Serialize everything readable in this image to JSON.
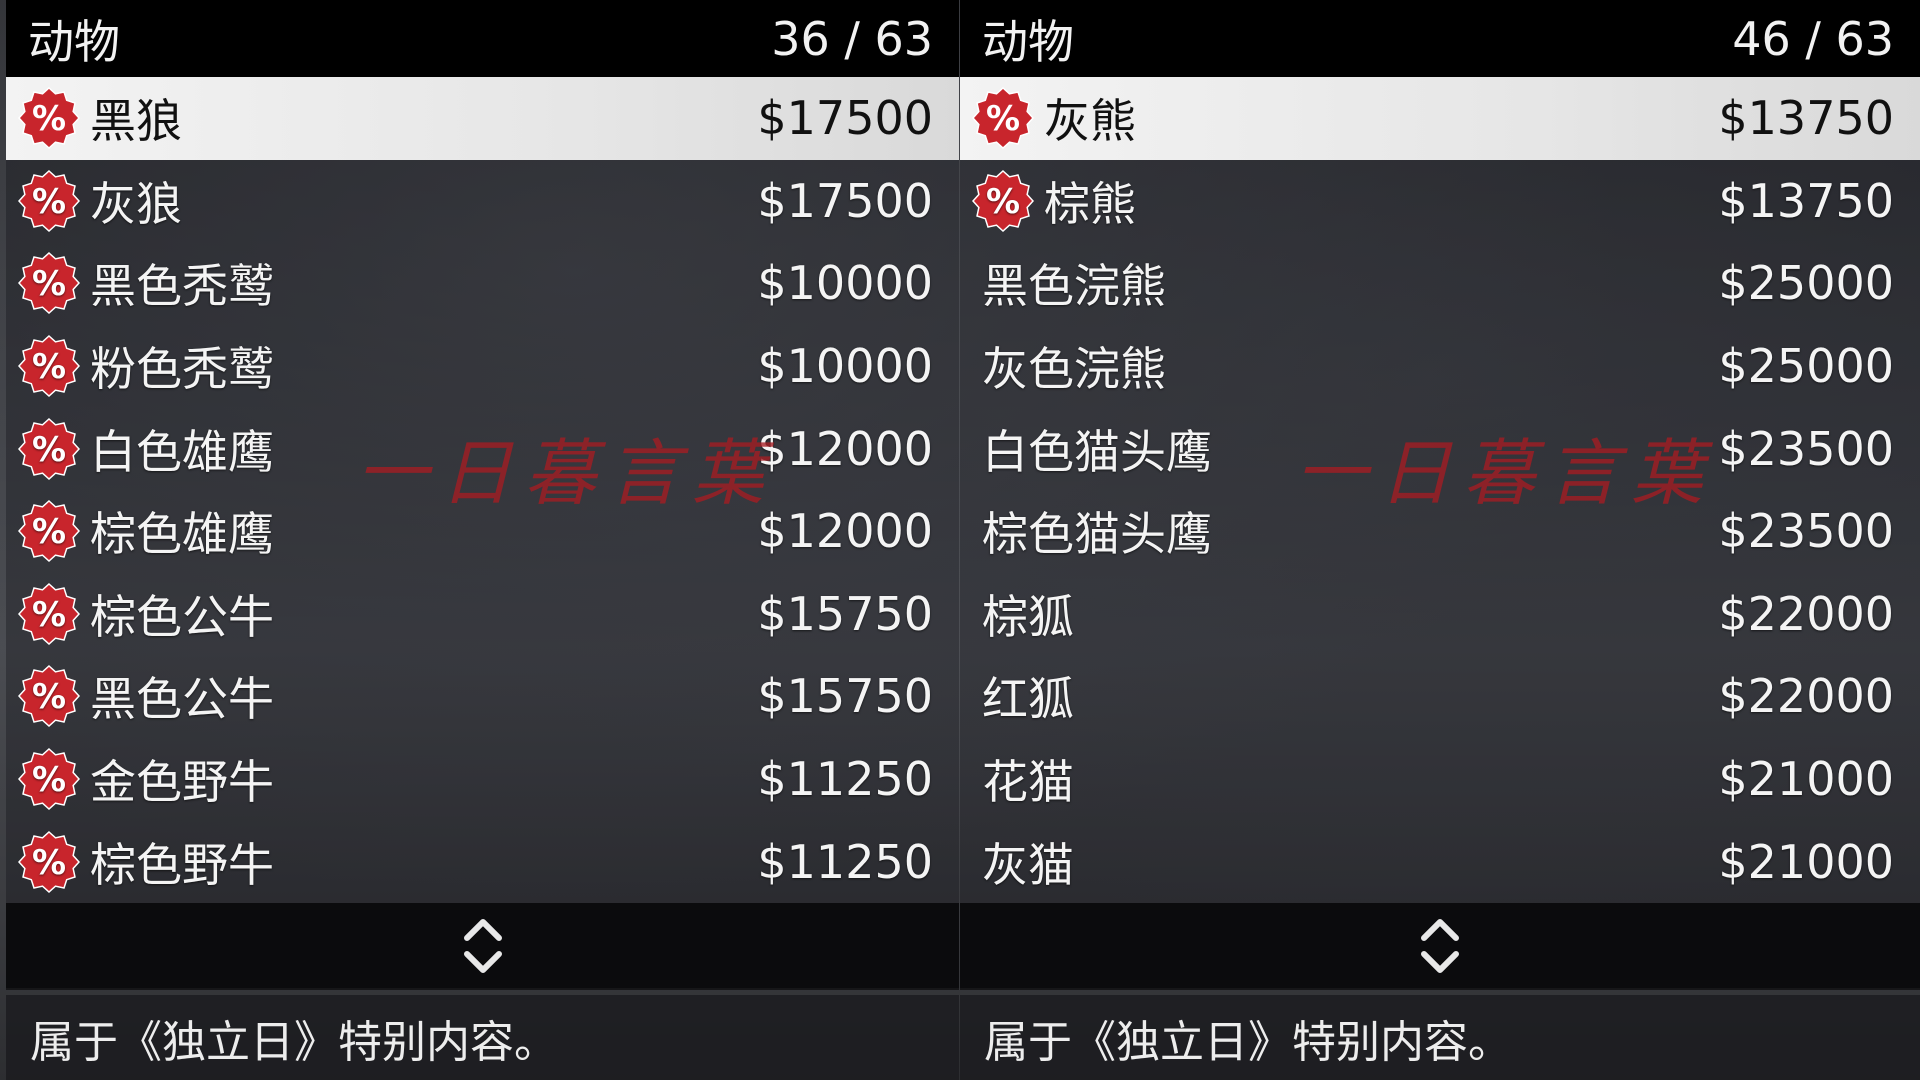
{
  "colors": {
    "accent_red": "#c8252c",
    "header_bg": "#000000",
    "selected_bg": "#e6e6e6"
  },
  "watermark": "一日暮言葉",
  "panels": [
    {
      "title": "动物",
      "counter": "36 / 63",
      "items": [
        {
          "label": "黑狼",
          "price": "$17500",
          "discount": true,
          "selected": true
        },
        {
          "label": "灰狼",
          "price": "$17500",
          "discount": true
        },
        {
          "label": "黑色秃鹫",
          "price": "$10000",
          "discount": true
        },
        {
          "label": "粉色秃鹫",
          "price": "$10000",
          "discount": true
        },
        {
          "label": "白色雄鹰",
          "price": "$12000",
          "discount": true
        },
        {
          "label": "棕色雄鹰",
          "price": "$12000",
          "discount": true
        },
        {
          "label": "棕色公牛",
          "price": "$15750",
          "discount": true
        },
        {
          "label": "黑色公牛",
          "price": "$15750",
          "discount": true
        },
        {
          "label": "金色野牛",
          "price": "$11250",
          "discount": true
        },
        {
          "label": "棕色野牛",
          "price": "$11250",
          "discount": true
        }
      ],
      "scroll_icon": "up-down-chevron-icon",
      "description": "属于《独立日》特别内容。"
    },
    {
      "title": "动物",
      "counter": "46 / 63",
      "items": [
        {
          "label": "灰熊",
          "price": "$13750",
          "discount": true,
          "selected": true
        },
        {
          "label": "棕熊",
          "price": "$13750",
          "discount": true
        },
        {
          "label": "黑色浣熊",
          "price": "$25000",
          "discount": false
        },
        {
          "label": "灰色浣熊",
          "price": "$25000",
          "discount": false
        },
        {
          "label": "白色猫头鹰",
          "price": "$23500",
          "discount": false
        },
        {
          "label": "棕色猫头鹰",
          "price": "$23500",
          "discount": false
        },
        {
          "label": "棕狐",
          "price": "$22000",
          "discount": false
        },
        {
          "label": "红狐",
          "price": "$22000",
          "discount": false
        },
        {
          "label": "花猫",
          "price": "$21000",
          "discount": false
        },
        {
          "label": "灰猫",
          "price": "$21000",
          "discount": false
        }
      ],
      "scroll_icon": "up-down-chevron-icon",
      "description": "属于《独立日》特别内容。"
    }
  ]
}
